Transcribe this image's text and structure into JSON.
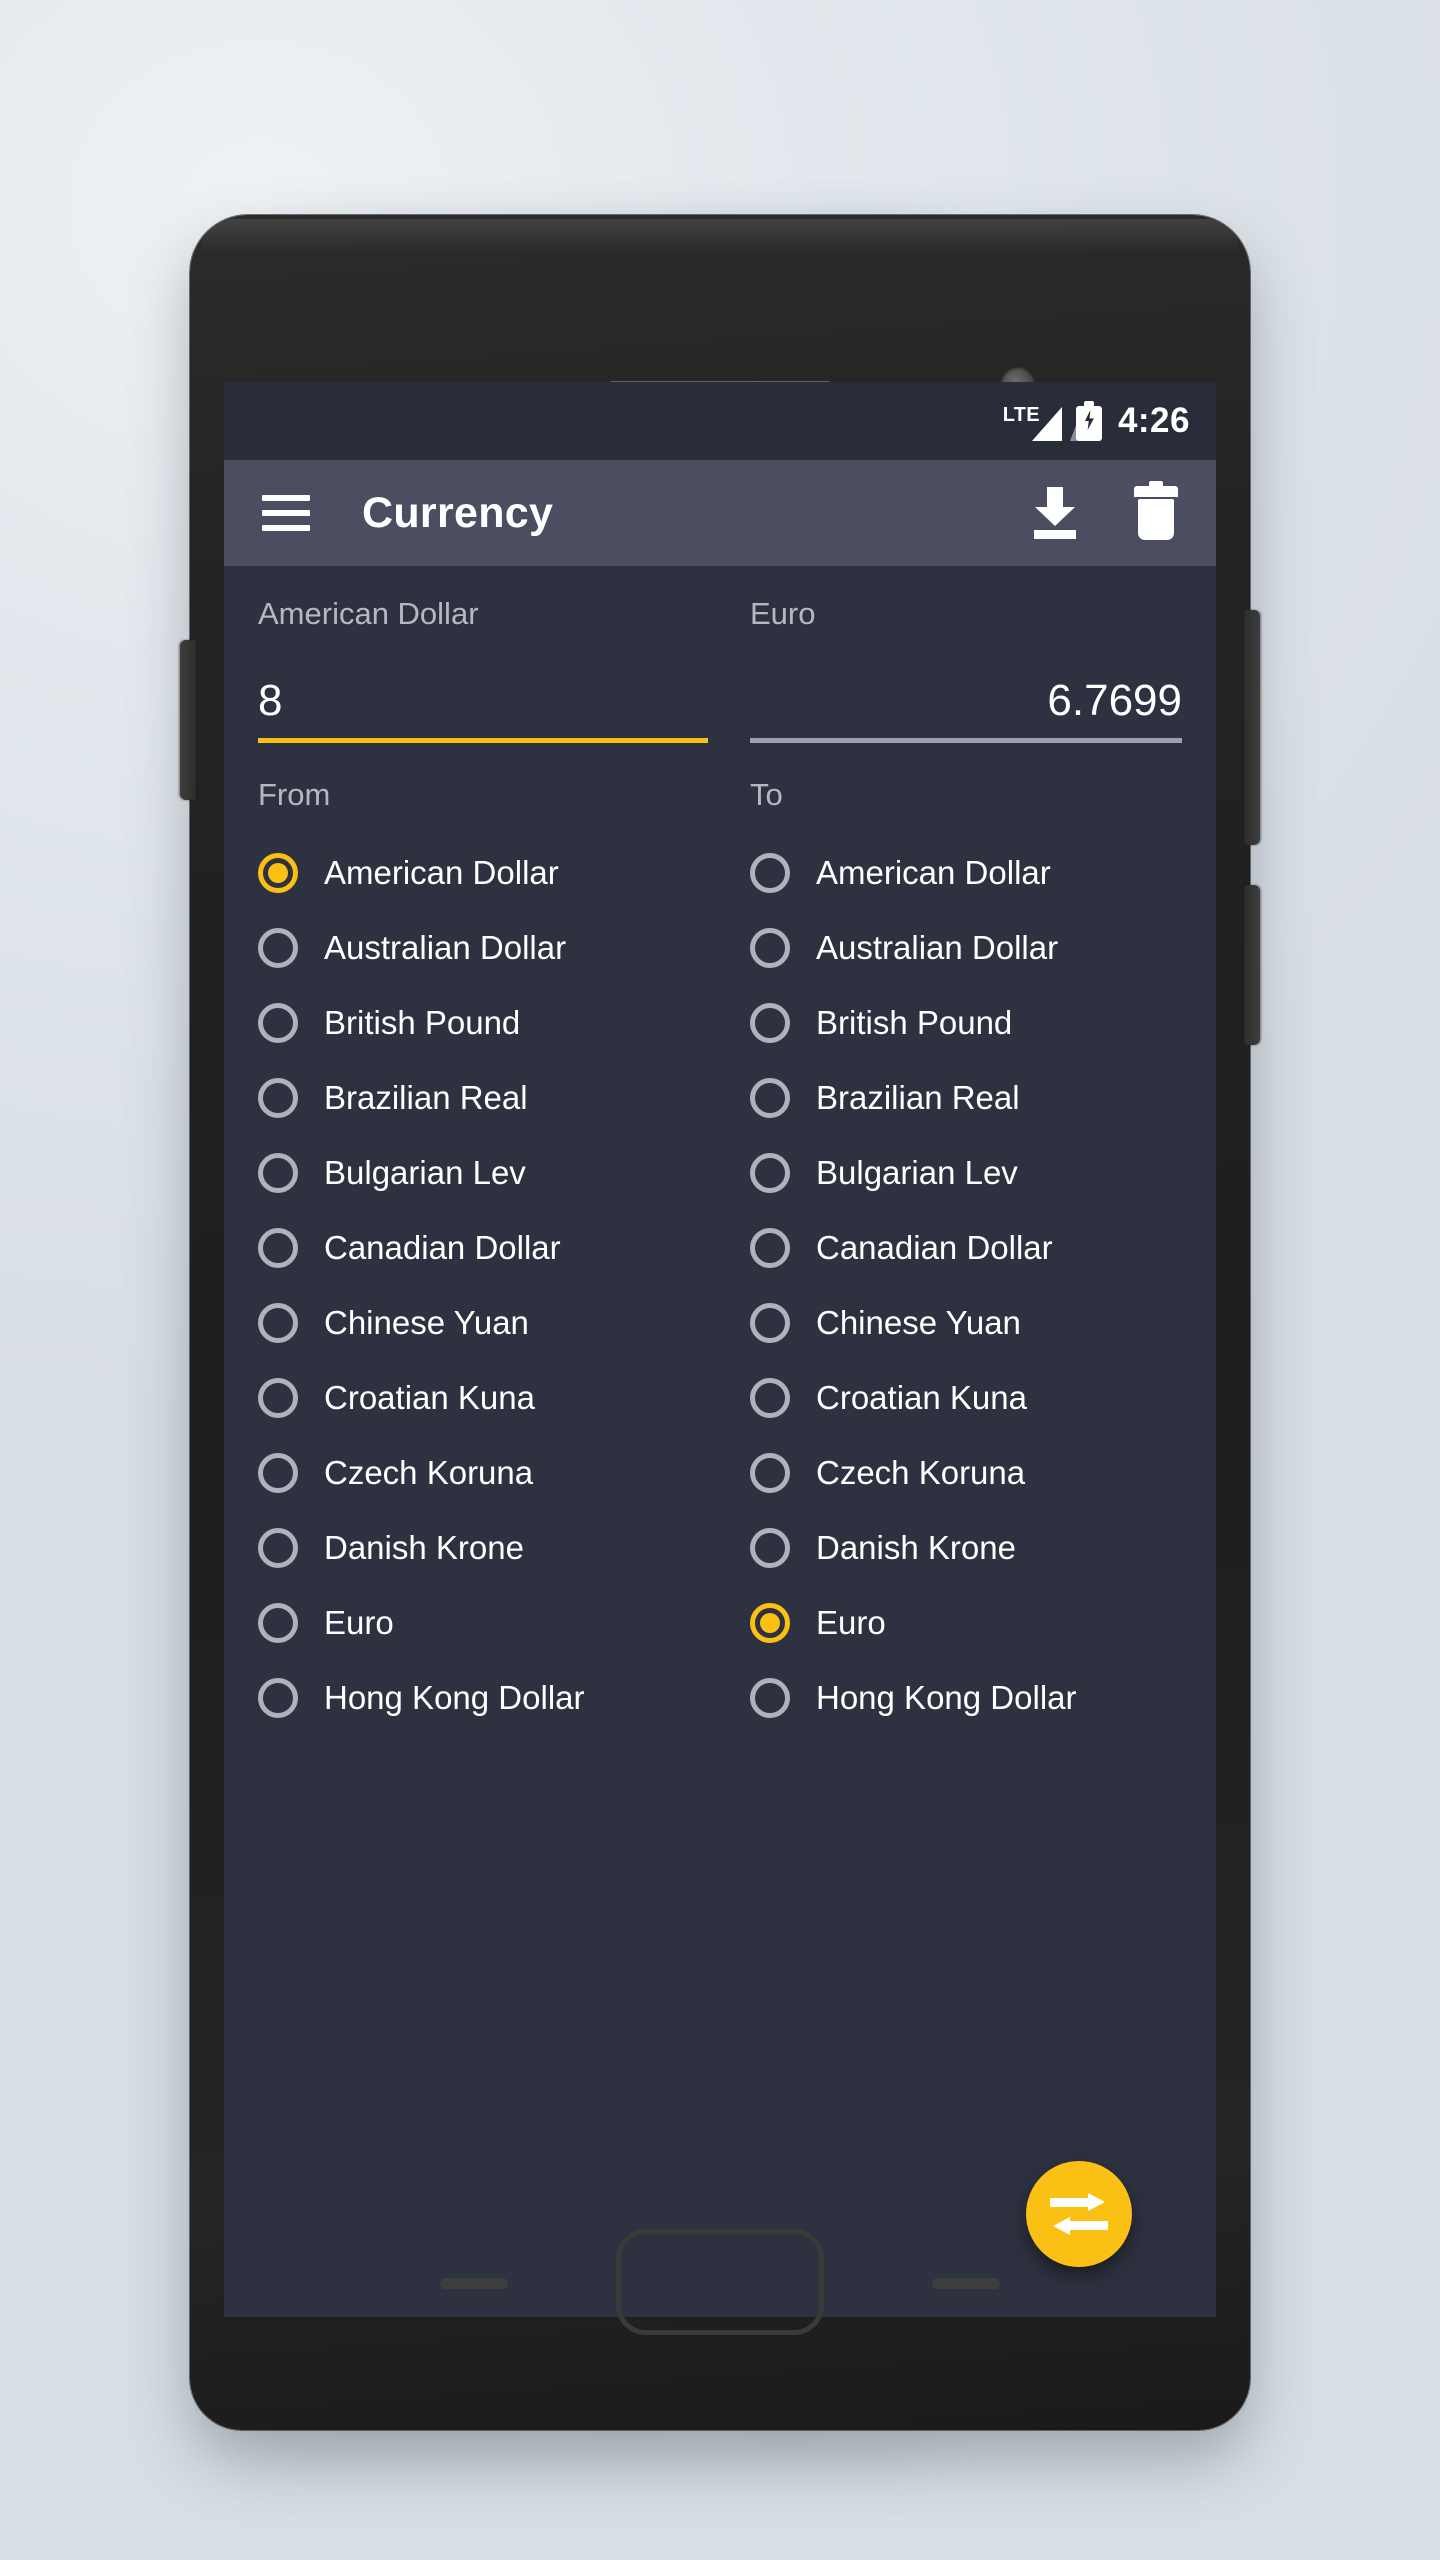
{
  "status_bar": {
    "network_label": "LTE",
    "time": "4:26",
    "battery_icon": "battery-charging-icon",
    "signal_icon": "signal-bars-icon"
  },
  "app_bar": {
    "menu_icon": "hamburger-menu-icon",
    "title": "Currency",
    "download_icon": "download-icon",
    "delete_icon": "trash-icon"
  },
  "converter": {
    "from": {
      "currency_label": "American Dollar",
      "value": "8",
      "active": true
    },
    "to": {
      "currency_label": "Euro",
      "value": "6.7699",
      "active": false
    }
  },
  "sections": {
    "from_label": "From",
    "to_label": "To"
  },
  "currencies": [
    "American Dollar",
    "Australian Dollar",
    "British Pound",
    "Brazilian Real",
    "Bulgarian Lev",
    "Canadian Dollar",
    "Chinese Yuan",
    "Croatian Kuna",
    "Czech Koruna",
    "Danish Krone",
    "Euro",
    "Hong Kong Dollar"
  ],
  "selection": {
    "from_selected": "American Dollar",
    "to_selected": "Euro"
  },
  "fab": {
    "icon": "swap-arrows-icon",
    "label": "Swap currencies"
  },
  "colors": {
    "accent": "#FAC013",
    "app_bar": "#4A4E60",
    "status_bar": "#292C39",
    "background": "#2E3140",
    "text_primary": "#FFFFFF",
    "text_secondary": "#B4B8C4",
    "radio_idle": "#AEB2BD"
  },
  "device": {
    "home_button": "home-button",
    "back_button": "back-button",
    "recents_button": "recents-button",
    "speaker": "earpiece-speaker",
    "camera": "front-camera"
  }
}
